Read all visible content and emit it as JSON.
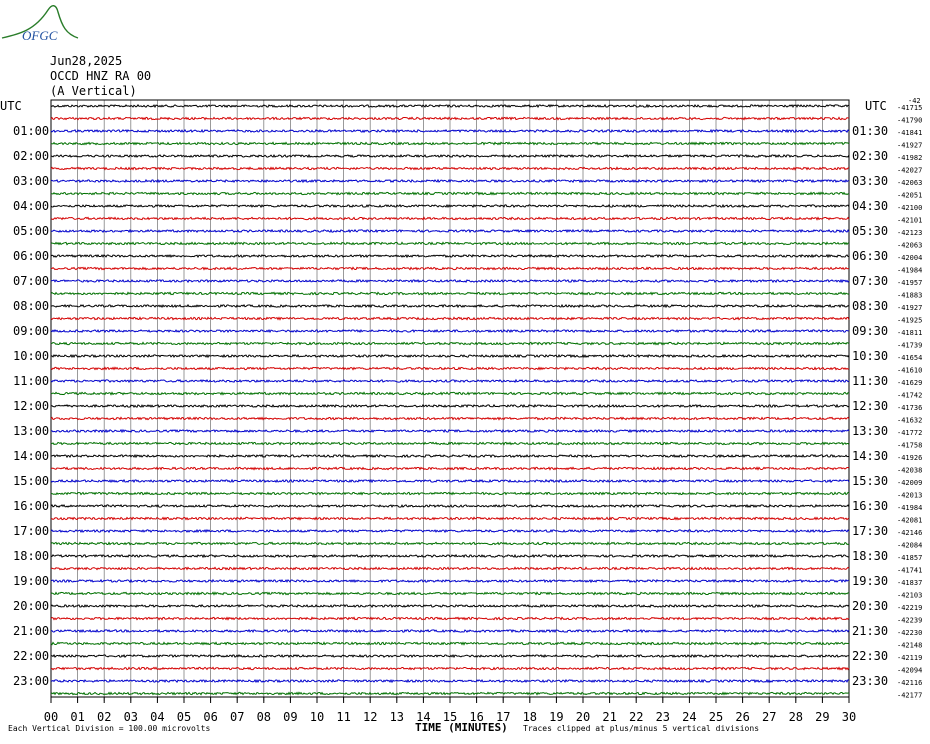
{
  "header": {
    "date": "Jun28,2025",
    "station": "OCCD HNZ RA 00",
    "component": "(A Vertical)",
    "logo_text": "OFGC"
  },
  "utc_label_left": "UTC",
  "utc_label_right": "UTC",
  "footer": {
    "division_note": "Each Vertical Division =  100.00 microvolts",
    "xaxis_title": "TIME (MINUTES)",
    "clip_note": "Traces clipped at plus/minus 5 vertical divisions"
  },
  "colors": {
    "trace_cycle": [
      "#000000",
      "#d40000",
      "#0000cc",
      "#007000"
    ],
    "grid": "#808080",
    "logo": "#2a7d2a"
  },
  "chart_data": {
    "type": "line",
    "x_range": [
      0,
      30
    ],
    "x_ticks": [
      "00",
      "01",
      "02",
      "03",
      "04",
      "05",
      "06",
      "07",
      "08",
      "09",
      "10",
      "11",
      "12",
      "13",
      "14",
      "15",
      "16",
      "17",
      "18",
      "19",
      "20",
      "21",
      "22",
      "23",
      "24",
      "25",
      "26",
      "27",
      "28",
      "29",
      "30"
    ],
    "rows_left_labels": [
      "",
      "01:00",
      "02:00",
      "03:00",
      "04:00",
      "05:00",
      "06:00",
      "07:00",
      "08:00",
      "09:00",
      "10:00",
      "11:00",
      "12:00",
      "13:00",
      "14:00",
      "15:00",
      "16:00",
      "17:00",
      "18:00",
      "19:00",
      "20:00",
      "21:00",
      "22:00",
      "23:00"
    ],
    "rows_right_labels": [
      "",
      "01:30",
      "02:30",
      "03:30",
      "04:30",
      "05:30",
      "06:30",
      "07:30",
      "08:30",
      "09:30",
      "10:30",
      "11:30",
      "12:30",
      "13:30",
      "14:30",
      "15:30",
      "16:30",
      "17:30",
      "18:30",
      "19:30",
      "20:30",
      "21:30",
      "22:30",
      "23:30"
    ],
    "offsets": [
      "-41715",
      "-41790",
      "-41841",
      "-41927",
      "-41982",
      "-42027",
      "-42063",
      "-42051",
      "-42100",
      "-42101",
      "-42123",
      "-42063",
      "-42004",
      "-41984",
      "-41957",
      "-41883",
      "-41927",
      "-41925",
      "-41811",
      "-41739",
      "-41654",
      "-41610",
      "-41629",
      "-41742",
      "-41736",
      "-41632",
      "-41772",
      "-41758",
      "-41926",
      "-42038",
      "-42009",
      "-42013",
      "-41984",
      "-42081",
      "-42146",
      "-42084",
      "-41857",
      "-41741",
      "-41837",
      "-42103",
      "-42219",
      "-42239",
      "-42230",
      "-42148",
      "-42119",
      "-42094",
      "-42116",
      "-42177"
    ],
    "top_extra_label": "-42",
    "amplitude_division_microvolts": 100.0
  }
}
